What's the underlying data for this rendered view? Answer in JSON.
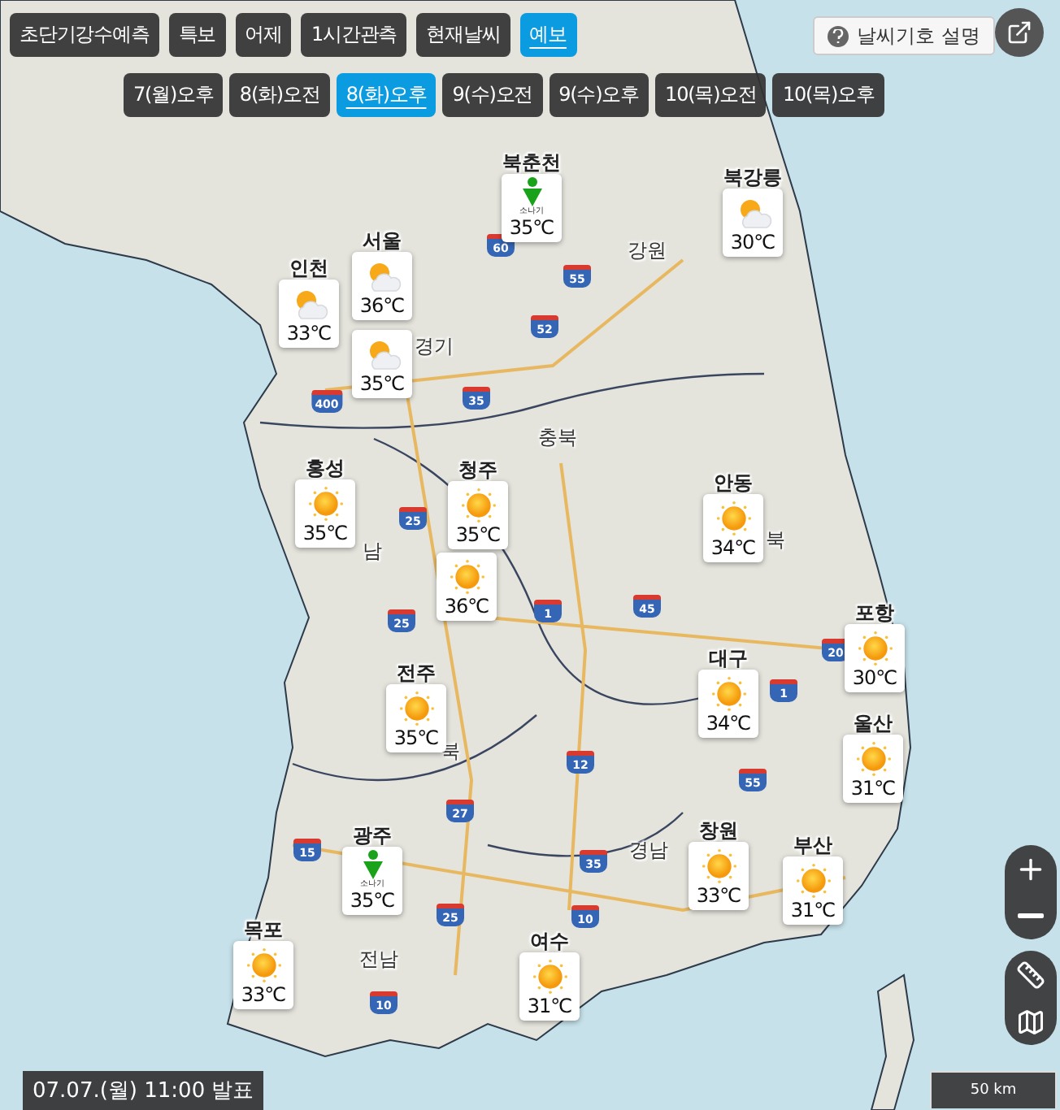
{
  "tabs": [
    {
      "label": "초단기강수예측",
      "selected": false
    },
    {
      "label": "특보",
      "selected": false
    },
    {
      "label": "어제",
      "selected": false
    },
    {
      "label": "1시간관측",
      "selected": false
    },
    {
      "label": "현재날씨",
      "selected": false
    },
    {
      "label": "예보",
      "selected": true
    }
  ],
  "times": [
    {
      "label": "7(월)오후",
      "selected": false
    },
    {
      "label": "8(화)오전",
      "selected": false
    },
    {
      "label": "8(화)오후",
      "selected": true
    },
    {
      "label": "9(수)오전",
      "selected": false
    },
    {
      "label": "9(수)오후",
      "selected": false
    },
    {
      "label": "10(목)오전",
      "selected": false
    },
    {
      "label": "10(목)오후",
      "selected": false
    }
  ],
  "legend_button": "날씨기호 설명",
  "regions": [
    "강원",
    "경기",
    "충북",
    "남",
    "북",
    "북",
    "경남",
    "전남"
  ],
  "highways": [
    "60",
    "55",
    "52",
    "400",
    "35",
    "25",
    "25",
    "1",
    "45",
    "12",
    "27",
    "15",
    "25",
    "35",
    "10",
    "10",
    "20",
    "1",
    "55"
  ],
  "markers": [
    {
      "label": "북춘천",
      "kind": "shower",
      "caption": "소나기",
      "temp": "35℃"
    },
    {
      "label": "북강릉",
      "kind": "partly",
      "temp": "30℃"
    },
    {
      "label": "인천",
      "kind": "partly",
      "temp": "33℃"
    },
    {
      "label": "서울",
      "kind": "partly",
      "temp": "36℃"
    },
    {
      "kind": "partly",
      "temp": "35℃"
    },
    {
      "label": "홍성",
      "kind": "sun",
      "temp": "35℃"
    },
    {
      "label": "청주",
      "kind": "sun",
      "temp": "35℃"
    },
    {
      "kind": "sun",
      "temp": "36℃"
    },
    {
      "label": "안동",
      "kind": "sun",
      "temp": "34℃"
    },
    {
      "label": "포항",
      "kind": "sun",
      "temp": "30℃"
    },
    {
      "label": "대구",
      "kind": "sun",
      "temp": "34℃"
    },
    {
      "label": "전주",
      "kind": "sun",
      "temp": "35℃"
    },
    {
      "label": "울산",
      "kind": "sun",
      "temp": "31℃"
    },
    {
      "label": "광주",
      "kind": "shower",
      "caption": "소나기",
      "temp": "35℃"
    },
    {
      "label": "창원",
      "kind": "sun",
      "temp": "33℃"
    },
    {
      "label": "부산",
      "kind": "sun",
      "temp": "31℃"
    },
    {
      "label": "목포",
      "kind": "sun",
      "temp": "33℃"
    },
    {
      "label": "여수",
      "kind": "sun",
      "temp": "31℃"
    }
  ],
  "scale": "50 km",
  "issued": "07.07.(월) 11:00 발표"
}
